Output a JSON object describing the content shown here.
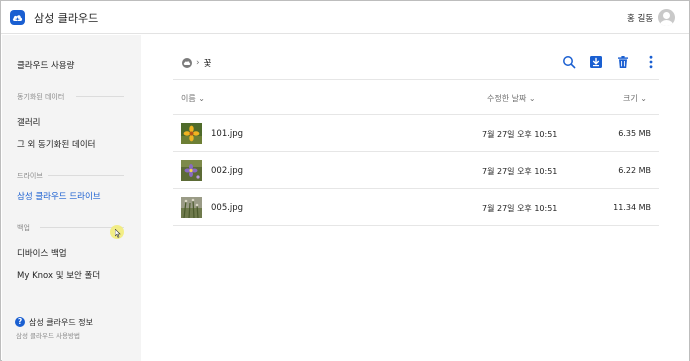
{
  "header": {
    "app_title": "삼성 클라우드",
    "user_name": "홍 길동"
  },
  "sidebar": {
    "usage": "클라우드 사용량",
    "sync_section": "동기화된 데이터",
    "gallery": "갤러리",
    "other_sync": "그 외 동기화된 데이터",
    "drive_section": "드라이브",
    "drive": "삼성 클라우드 드라이브",
    "backup_section": "백업",
    "device_backup": "디바이스 백업",
    "knox_folder": "My Knox 및 보안 폴더",
    "info_title": "삼성 클라우드 정보",
    "info_sub": "삼성 클라우드 사용방법"
  },
  "breadcrumb": {
    "current": "꽃"
  },
  "columns": {
    "name": "이름",
    "modified": "수정한 날짜",
    "size": "크기"
  },
  "files": [
    {
      "name": "101.jpg",
      "date": "7월 27일 오후 10:51",
      "size": "6.35 MB"
    },
    {
      "name": "002.jpg",
      "date": "7월 27일 오후 10:51",
      "size": "6.22 MB"
    },
    {
      "name": "005.jpg",
      "date": "7월 27일 오후 10:51",
      "size": "11.34 MB"
    }
  ],
  "colors": {
    "accent": "#1a5fd1",
    "sidebar_bg": "#f4f4f4",
    "muted": "#8a8a8a"
  },
  "icons": [
    "cloud-logo-icon",
    "avatar-icon",
    "cloud-icon",
    "chevron-right-icon",
    "search-icon",
    "download-icon",
    "trash-icon",
    "more-icon",
    "chevron-down-icon",
    "help-icon"
  ]
}
